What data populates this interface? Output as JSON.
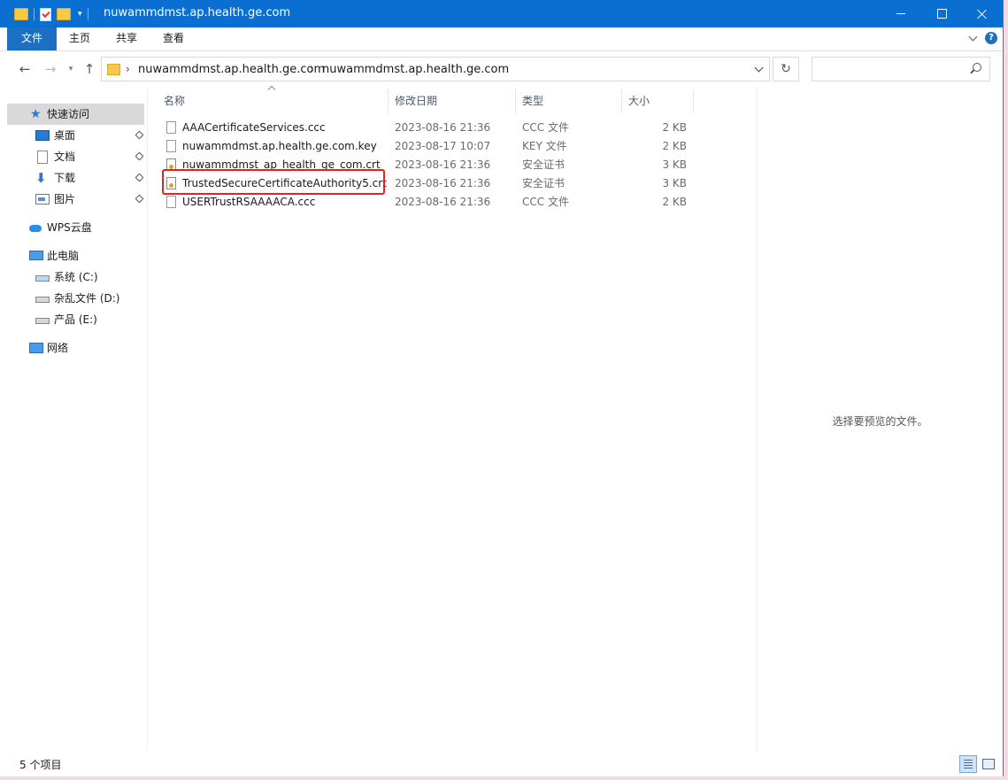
{
  "window": {
    "title": "nuwammdmst.ap.health.ge.com"
  },
  "ribbon": {
    "tabs": [
      "文件",
      "主页",
      "共享",
      "查看"
    ]
  },
  "address": {
    "crumbs": [
      "nuwammdmst.ap.health.ge.com",
      "nuwammdmst.ap.health.ge.com"
    ],
    "search_placeholder": ""
  },
  "sidebar": {
    "quick_access": "快速访问",
    "desktop": "桌面",
    "documents": "文档",
    "downloads": "下载",
    "pictures": "图片",
    "wps_cloud": "WPS云盘",
    "this_pc": "此电脑",
    "drive_c": "系统 (C:)",
    "drive_d": "杂乱文件 (D:)",
    "drive_e": "产品 (E:)",
    "network": "网络"
  },
  "columns": {
    "name": "名称",
    "date": "修改日期",
    "type": "类型",
    "size": "大小"
  },
  "files": [
    {
      "name": "AAACertificateServices.ccc",
      "date": "2023-08-16 21:36",
      "type": "CCC 文件",
      "size": "2 KB",
      "icon": "file-icon"
    },
    {
      "name": "nuwammdmst.ap.health.ge.com.key",
      "date": "2023-08-17 10:07",
      "type": "KEY 文件",
      "size": "2 KB",
      "icon": "file-icon"
    },
    {
      "name": "nuwammdmst_ap_health_ge_com.crt",
      "date": "2023-08-16 21:36",
      "type": "安全证书",
      "size": "3 KB",
      "icon": "certificate-icon"
    },
    {
      "name": "TrustedSecureCertificateAuthority5.crt",
      "date": "2023-08-16 21:36",
      "type": "安全证书",
      "size": "3 KB",
      "icon": "certificate-icon"
    },
    {
      "name": "USERTrustRSAAAACA.ccc",
      "date": "2023-08-16 21:36",
      "type": "CCC 文件",
      "size": "2 KB",
      "icon": "file-icon"
    }
  ],
  "preview": {
    "message": "选择要预览的文件。"
  },
  "status": {
    "item_count": "5 个项目"
  },
  "colors": {
    "titlebar": "#0a6fd0",
    "highlight": "#e02424",
    "selection": "#d9d9d9"
  }
}
